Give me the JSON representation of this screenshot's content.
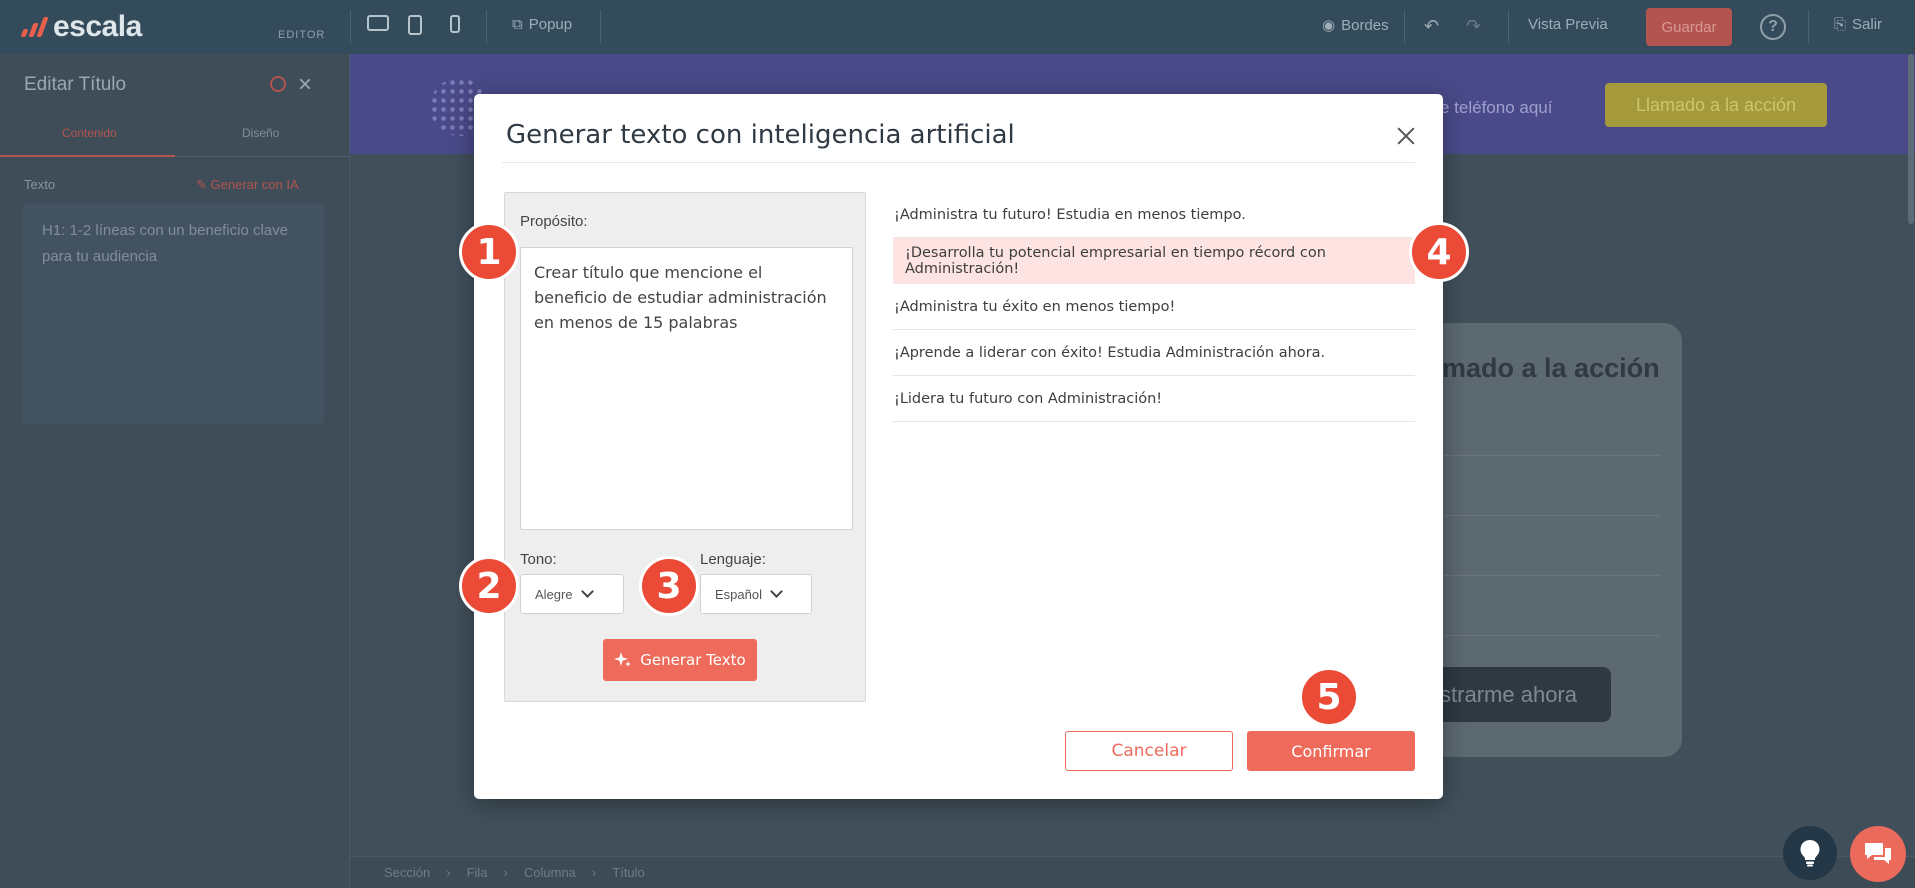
{
  "topbar": {
    "logo": "escala",
    "editor_tag": "EDITOR",
    "popup": "Popup",
    "bordes": "Bordes",
    "vista_previa": "Vista Previa",
    "guardar": "Guardar",
    "help": "?",
    "salir": "Salir"
  },
  "left_panel": {
    "title": "Editar Título",
    "tabs": [
      "Contenido",
      "Diseño"
    ],
    "texto_label": "Texto",
    "generar_ia": "Generar con IA",
    "text_value": "H1: 1-2 líneas con un beneficio clave para tu audiencia"
  },
  "page_preview": {
    "phone_text": "e teléfono aquí",
    "cta": "Llamado a la acción",
    "form_title": "mado a la acción",
    "form_button": "strarme ahora"
  },
  "breadcrumb": [
    "Sección",
    "Fila",
    "Columna",
    "Título"
  ],
  "modal": {
    "title": "Generar texto con inteligencia artificial",
    "proposito_label": "Propósito:",
    "proposito_value": "Crear título que mencione el beneficio de estudiar administración en menos de 15 palabras",
    "tono_label": "Tono:",
    "tono_value": "Alegre",
    "lenguaje_label": "Lenguaje:",
    "lenguaje_value": "Español",
    "generate_button": "Generar Texto",
    "results": [
      "¡Administra tu futuro! Estudia en menos tiempo.",
      "¡Desarrolla tu potencial empresarial en tiempo récord con Administración!",
      "¡Administra tu éxito en menos tiempo!",
      "¡Aprende a liderar con éxito! Estudia Administración ahora.",
      "¡Lidera tu futuro con Administración!"
    ],
    "selected_index": 1,
    "cancel_button": "Cancelar",
    "confirm_button": "Confirmar"
  },
  "steps": [
    "1",
    "2",
    "3",
    "4",
    "5"
  ],
  "colors": {
    "accent": "#ee6b5b",
    "step_marker": "#ea4a36",
    "selected_row": "#fde3e1"
  }
}
